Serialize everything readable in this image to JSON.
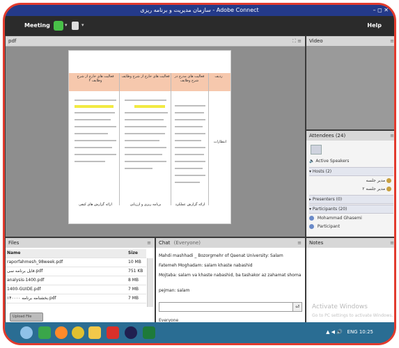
{
  "window": {
    "title": "سازمان مدیریت و برنامه ریزی - Adobe Connect",
    "controls": "– ◻ ✕"
  },
  "menubar": {
    "meeting": "Meeting",
    "help": "Help"
  },
  "share_pod": {
    "title": "pdf",
    "header_icons": "⛶ ≡",
    "doc": {
      "columns": [
        "ردیف",
        "فعالیت های مدرج در شرح وظایف",
        "فعالیت های خارج از شرح وظایف",
        "فعالیت های خارج از شرح وظایف ۲"
      ],
      "row_label": "انتظارات",
      "footers": [
        "ارائه گزارش عملکرد",
        "برنامه ریزی و ارزیابی",
        "ارائه گزارش های کیفی"
      ]
    }
  },
  "video_pod": {
    "title": "Video",
    "menu_icon": "≡"
  },
  "attendees_pod": {
    "title": "Attendees (24)",
    "menu_icon": "≡",
    "active_speakers": "Active Speakers",
    "hosts_label": "Hosts (2)",
    "hosts": [
      "مدیر جلسه",
      "مدیر جلسه ۲"
    ],
    "presenters_label": "Presenters (0)",
    "participants_label": "Participants (20)",
    "participants": [
      "Mohammad Ghasemi",
      "Participant"
    ]
  },
  "files_pod": {
    "title": "Files",
    "menu_icon": "≡",
    "col_name": "Name",
    "col_size": "Size",
    "rows": [
      {
        "name": "raporfahmesh_98week.pdf",
        "size": "10 MB"
      },
      {
        "name": "فایل برنامه سی.pdf",
        "size": "751 KB"
      },
      {
        "name": "analysis-1400.pdf",
        "size": "8 MB"
      },
      {
        "name": "1400-GUIDE.pdf",
        "size": "7 MB"
      },
      {
        "name": "۱۴۰۰۰۰ بخشنامه برنامه.pdf",
        "size": "7 MB"
      }
    ],
    "button_label": "Upload File"
  },
  "chat_pod": {
    "title": "Chat",
    "scope": "(Everyone)",
    "menu_icon": "≡",
    "messages": [
      "Mahdi mashhadi _ Bozorgmehr of Qaenat University: Salam",
      "Fatemeh Moghadam: salam khaste nabashid",
      "Mojtaba: salam va khaste nabashid, ba tashakor az zahamat shoma",
      "pejman: salam"
    ],
    "send_icon": "⏎",
    "to_label": "Everyone"
  },
  "notes_pod": {
    "title": "Notes",
    "menu_icon": "≡",
    "watermark_title": "Activate Windows",
    "watermark_sub": "Go to PC settings to activate Windows."
  },
  "taskbar": {
    "tray": "▲ ◀ 🔊",
    "clock": "ENG 10:25"
  },
  "colors": {
    "frame": "#e23b2e",
    "titlebar": "#243a8a",
    "taskbar": "#2a6d93"
  }
}
